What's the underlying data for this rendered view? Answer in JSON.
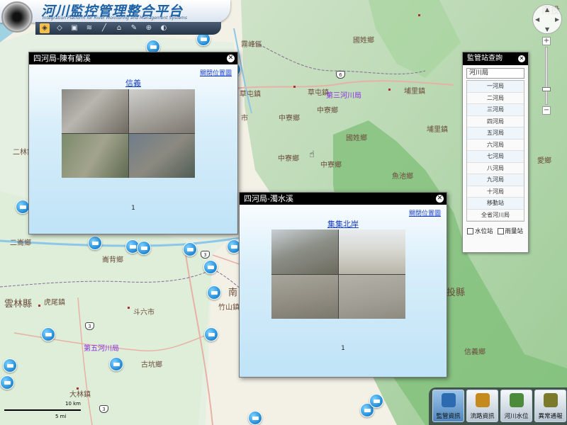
{
  "app": {
    "title": "河川監控管理整合平台",
    "subtitle": "Integration Platform for River Monitoring and Management Systems"
  },
  "toolbar": {
    "tools": [
      "layer-tool",
      "move-tool",
      "map-tool",
      "stack-tool",
      "draw-tool",
      "area-tool",
      "measure-tool",
      "locate-tool",
      "toggle-tool"
    ]
  },
  "map": {
    "places": [
      {
        "name": "南投",
        "style": "big"
      },
      {
        "name": "國姓鄉",
        "style": "normal"
      },
      {
        "name": "霧峰區",
        "style": "normal"
      },
      {
        "name": "草屯鎮",
        "style": "normal"
      },
      {
        "name": "第三河川局",
        "style": "purple"
      },
      {
        "name": "埔里鎮",
        "style": "normal"
      },
      {
        "name": "中寮鄉",
        "style": "normal"
      },
      {
        "name": "國姓鄉",
        "style": "normal"
      },
      {
        "name": "埔里鎮",
        "style": "normal"
      },
      {
        "name": "中寮鄉",
        "style": "normal"
      },
      {
        "name": "中寮鄉",
        "style": "normal"
      },
      {
        "name": "魚池鄉",
        "style": "normal"
      },
      {
        "name": "二林鎮",
        "style": "normal"
      },
      {
        "name": "二崙鄉",
        "style": "normal"
      },
      {
        "name": "崙背鄉",
        "style": "normal"
      },
      {
        "name": "雲林縣",
        "style": "big"
      },
      {
        "name": "虎尾鎮",
        "style": "normal"
      },
      {
        "name": "斗六市",
        "style": "normal"
      },
      {
        "name": "第五河川局",
        "style": "purple"
      },
      {
        "name": "古坑鄉",
        "style": "normal"
      },
      {
        "name": "大林鎮",
        "style": "normal"
      },
      {
        "name": "竹山鎮",
        "style": "normal"
      },
      {
        "name": "信義鄉",
        "style": "normal"
      },
      {
        "name": "南",
        "style": "big"
      },
      {
        "name": "投縣",
        "style": "big"
      },
      {
        "name": "愛鄉",
        "style": "normal"
      },
      {
        "name": "市",
        "style": "normal"
      }
    ],
    "route_numbers": [
      "6",
      "3",
      "3",
      "3"
    ],
    "scale": {
      "major": "10 km",
      "minor": "5 mi"
    }
  },
  "popups": [
    {
      "title": "四河局-陳有蘭溪",
      "close_view_label": "關閉位置圖",
      "station": "信義",
      "page": "1"
    },
    {
      "title": "四河局-濁水溪",
      "close_view_label": "關閉位置圖",
      "station": "集集北岸",
      "page": "1"
    }
  ],
  "station_panel": {
    "title": "監管站查詢",
    "category": "河川局",
    "items": [
      "一河局",
      "二河局",
      "三河局",
      "四河局",
      "五河局",
      "六河局",
      "七河局",
      "八河局",
      "九河局",
      "十河局",
      "移動站",
      "全省河川局"
    ],
    "checkbox_water": "水位站",
    "checkbox_rain": "雨量站"
  },
  "zoom": {
    "plus": "+",
    "minus": "−",
    "level_fraction": 0.76
  },
  "nav": {
    "n": "▲",
    "s": "▼",
    "w": "◀",
    "e": "▶"
  },
  "bottom_buttons": [
    {
      "label": "監管資訊",
      "active": true,
      "color": "#2c6bb0"
    },
    {
      "label": "流路資訊",
      "active": false,
      "color": "#c58a1c"
    },
    {
      "label": "河川水位",
      "active": false,
      "color": "#4c8a3c"
    },
    {
      "label": "異常通報",
      "active": false,
      "color": "#7a7a2a"
    }
  ]
}
